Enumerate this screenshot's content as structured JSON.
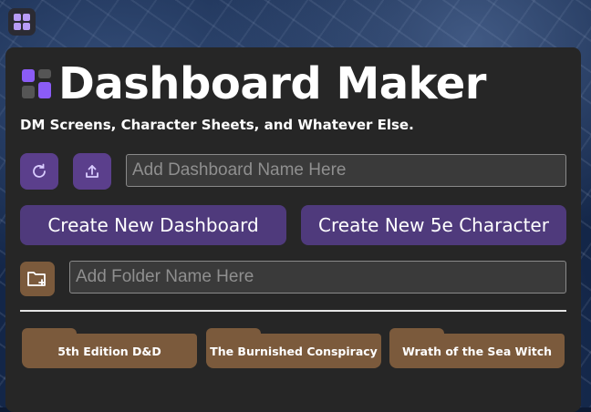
{
  "app": {
    "title": "Dashboard Maker",
    "subtitle": "DM Screens, Character Sheets, and Whatever Else."
  },
  "toolbar": {
    "refresh_icon": "refresh-icon",
    "upload_icon": "upload-icon",
    "dashboard_name_placeholder": "Add Dashboard Name Here",
    "dashboard_name_value": ""
  },
  "actions": {
    "create_dashboard_label": "Create New Dashboard",
    "create_character_label": "Create New 5e Character"
  },
  "folder": {
    "add_folder_icon": "folder-plus-icon",
    "folder_name_placeholder": "Add Folder Name Here",
    "folder_name_value": ""
  },
  "folders": [
    {
      "label": "5th Edition D&D"
    },
    {
      "label": "The Burnished Conspiracy"
    },
    {
      "label": "Wrath of the Sea Witch"
    }
  ],
  "colors": {
    "panel": "#262626",
    "accent_purple": "#5b3f8c",
    "button_purple": "#4f3a7c",
    "folder_brown": "#7b5a3c",
    "logo_purple": "#8b5cf6",
    "logo_gray": "#555555"
  }
}
